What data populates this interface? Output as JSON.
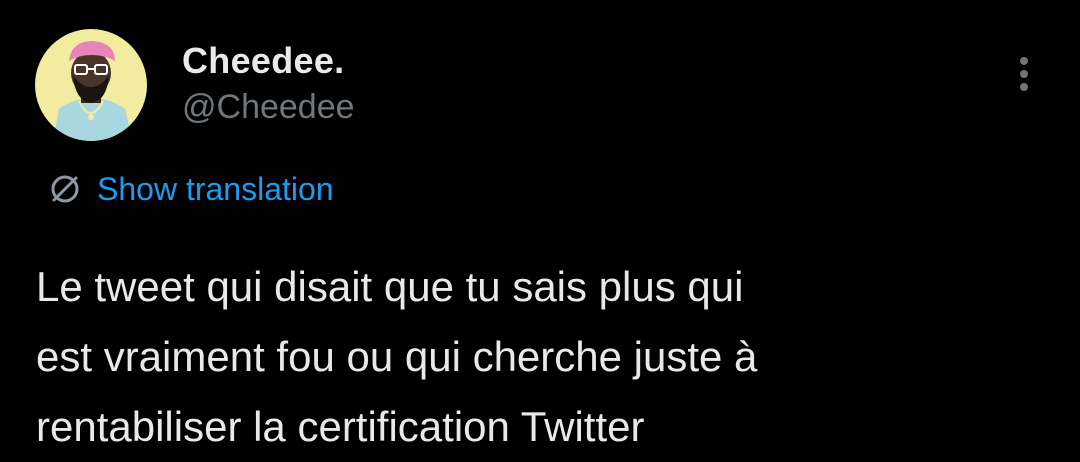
{
  "tweet": {
    "author": {
      "display_name": "Cheedee.",
      "handle": "@Cheedee"
    },
    "translate_link": "Show translation",
    "text_lines": [
      "Le tweet qui disait que tu sais plus qui",
      "est vraiment fou ou qui cherche juste à",
      "rentabiliser la certification Twitter"
    ]
  },
  "icons": {
    "more": "more-vertical-icon",
    "translate": "globe-icon"
  },
  "colors": {
    "background": "#000000",
    "primary_text": "#e7e9ea",
    "secondary_text": "#71767b",
    "link": "#1d9bf0",
    "avatar_background": "#f2eca0"
  }
}
